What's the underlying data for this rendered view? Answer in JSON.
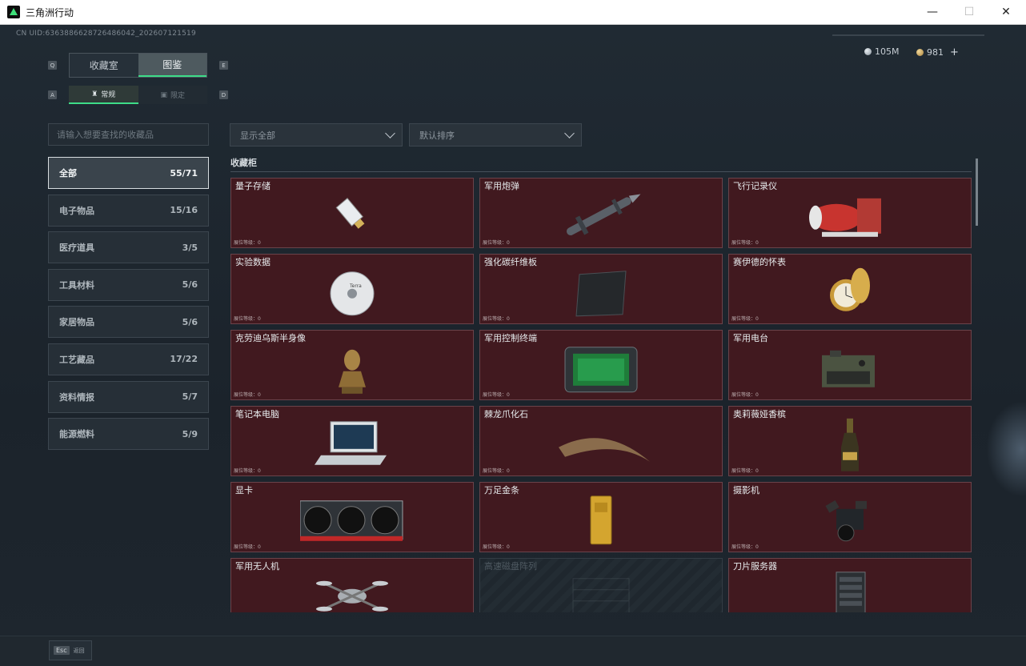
{
  "window": {
    "title": "三角洲行动",
    "min": "—",
    "max": "☐",
    "close": "✕"
  },
  "header": {
    "uid": "CN UID:6363886628726486042_202607121519",
    "currency_silver": "105M",
    "currency_gold": "981",
    "add": "+"
  },
  "tabs": [
    {
      "label": "收藏室"
    },
    {
      "label": "图鉴"
    }
  ],
  "tab_keys": {
    "left": "Q",
    "right": "E"
  },
  "subtabs": [
    {
      "label": "常规"
    },
    {
      "label": "限定"
    }
  ],
  "subtab_keys": {
    "left": "A",
    "right": "D"
  },
  "search": {
    "placeholder": "请输入想要查找的收藏品"
  },
  "filter": {
    "value": "显示全部"
  },
  "sort": {
    "value": "默认排序"
  },
  "categories": [
    {
      "label": "全部",
      "count": "55/71"
    },
    {
      "label": "电子物品",
      "count": "15/16"
    },
    {
      "label": "医疗道具",
      "count": "3/5"
    },
    {
      "label": "工具材料",
      "count": "5/6"
    },
    {
      "label": "家居物品",
      "count": "5/6"
    },
    {
      "label": "工艺藏品",
      "count": "17/22"
    },
    {
      "label": "资料情报",
      "count": "5/7"
    },
    {
      "label": "能源燃料",
      "count": "5/9"
    }
  ],
  "section": {
    "title": "收藏柜"
  },
  "level_label": "展位等级：0",
  "items": [
    {
      "name": "量子存储",
      "icon": "usb-drive-icon",
      "locked": false
    },
    {
      "name": "军用炮弹",
      "icon": "missile-icon",
      "locked": false
    },
    {
      "name": "飞行记录仪",
      "icon": "flight-recorder-icon",
      "locked": false
    },
    {
      "name": "实验数据",
      "icon": "disc-icon",
      "locked": false
    },
    {
      "name": "强化碳纤维板",
      "icon": "carbon-plate-icon",
      "locked": false
    },
    {
      "name": "赛伊德的怀表",
      "icon": "pocket-watch-icon",
      "locked": false
    },
    {
      "name": "克劳迪乌斯半身像",
      "icon": "bust-icon",
      "locked": false
    },
    {
      "name": "军用控制终端",
      "icon": "terminal-icon",
      "locked": false
    },
    {
      "name": "军用电台",
      "icon": "radio-icon",
      "locked": false
    },
    {
      "name": "笔记本电脑",
      "icon": "laptop-icon",
      "locked": false
    },
    {
      "name": "棘龙爪化石",
      "icon": "claw-fossil-icon",
      "locked": false
    },
    {
      "name": "奥莉薇娅香槟",
      "icon": "champagne-icon",
      "locked": false
    },
    {
      "name": "显卡",
      "icon": "gpu-icon",
      "locked": false
    },
    {
      "name": "万足金条",
      "icon": "gold-bar-icon",
      "locked": false
    },
    {
      "name": "摄影机",
      "icon": "camera-icon",
      "locked": false
    },
    {
      "name": "军用无人机",
      "icon": "drone-icon",
      "locked": false
    },
    {
      "name": "高速磁盘阵列",
      "icon": "disk-array-icon",
      "locked": true
    },
    {
      "name": "刀片服务器",
      "icon": "server-icon",
      "locked": false
    }
  ],
  "footer": {
    "esc_key": "Esc",
    "back": "返回"
  }
}
